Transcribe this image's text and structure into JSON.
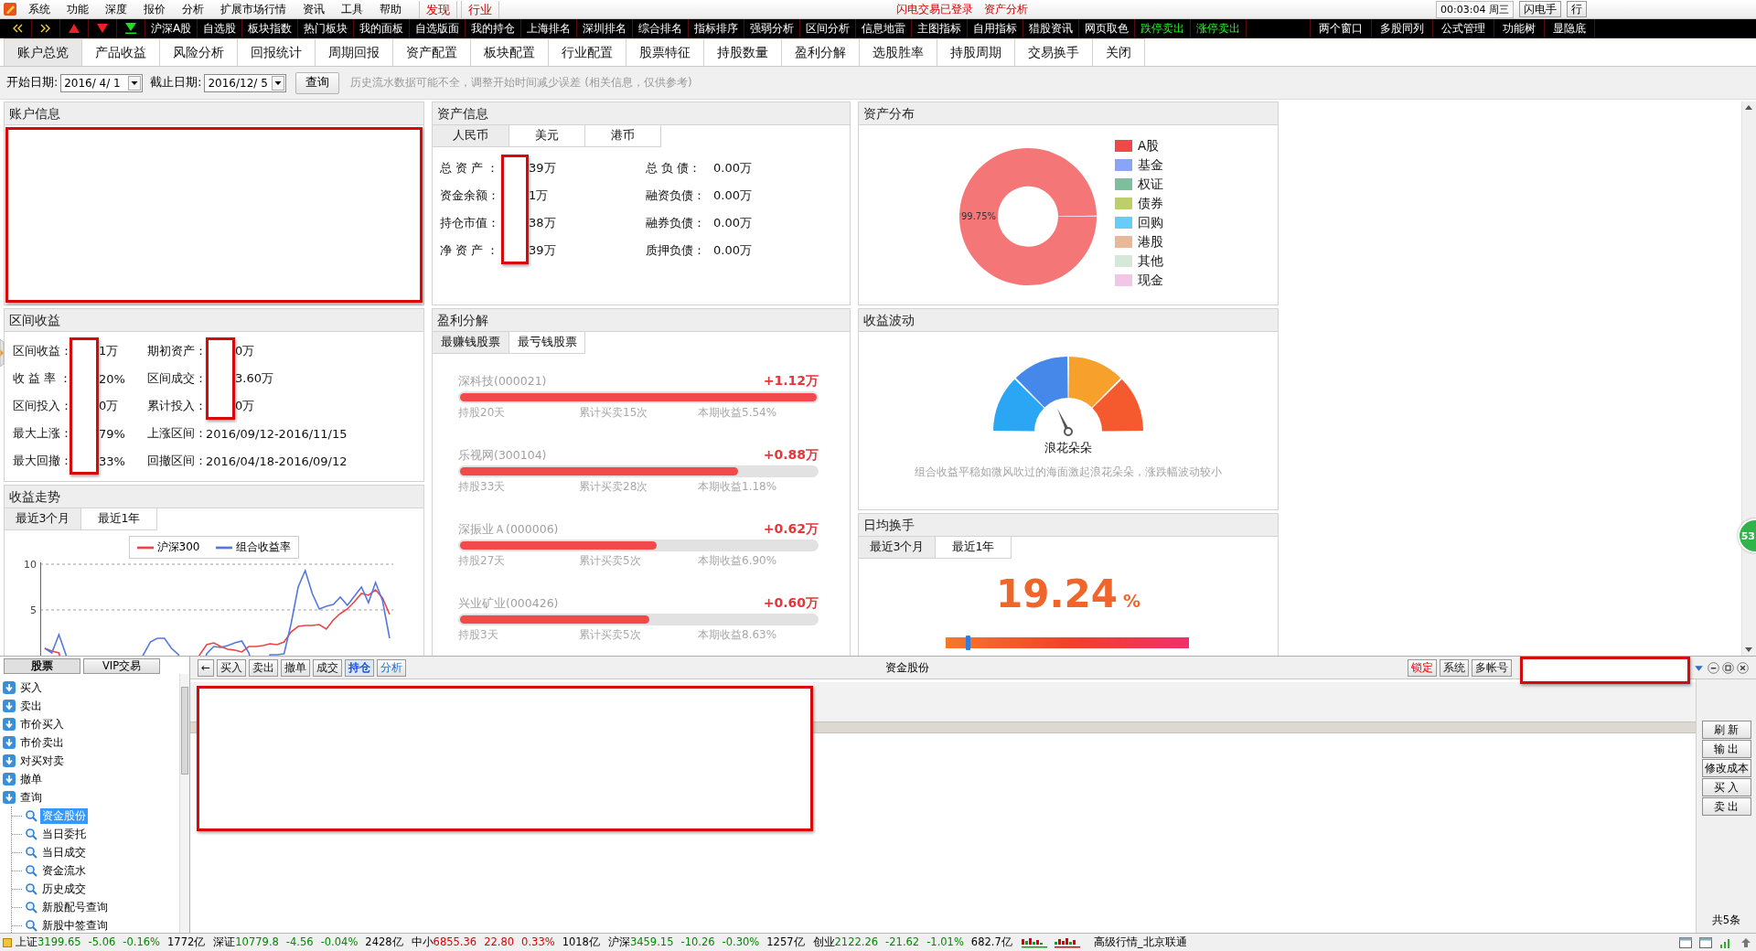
{
  "menu_bar": {
    "items": [
      "系统",
      "功能",
      "深度",
      "报价",
      "分析",
      "扩展市场行情",
      "资讯",
      "工具",
      "帮助"
    ],
    "tabs": [
      "发现",
      "行业"
    ],
    "links": [
      "闪电交易已登录",
      "资产分析"
    ],
    "clock": "00:03:04 周三",
    "buttons": [
      "闪电手",
      "行"
    ]
  },
  "quick_bar": {
    "items": [
      {
        "label": "沪深A股",
        "kind": "plain"
      },
      {
        "label": "自选股",
        "kind": "plain"
      },
      {
        "label": "板块指数",
        "kind": "plain"
      },
      {
        "label": "热门板块",
        "kind": "plain"
      },
      {
        "label": "我的面板",
        "kind": "plain"
      },
      {
        "label": "自选版面",
        "kind": "plain"
      },
      {
        "label": "我的持仓",
        "kind": "plain"
      },
      {
        "label": "上海排名",
        "kind": "plain"
      },
      {
        "label": "深圳排名",
        "kind": "plain"
      },
      {
        "label": "综合排名",
        "kind": "plain"
      },
      {
        "label": "指标排序",
        "kind": "plain"
      },
      {
        "label": "强弱分析",
        "kind": "plain"
      },
      {
        "label": "区间分析",
        "kind": "plain"
      },
      {
        "label": "信息地雷",
        "kind": "plain"
      },
      {
        "label": "主图指标",
        "kind": "plain"
      },
      {
        "label": "自用指标",
        "kind": "plain"
      },
      {
        "label": "猎股资讯",
        "kind": "plain"
      },
      {
        "label": "网页取色",
        "kind": "plain"
      },
      {
        "label": "跌停卖出",
        "kind": "accent"
      },
      {
        "label": "涨停卖出",
        "kind": "accent"
      }
    ],
    "right_items": [
      "两个窗口",
      "多股同列",
      "公式管理",
      "功能树",
      "显隐底"
    ]
  },
  "tabs": [
    {
      "label": "账户总览",
      "selected": true
    },
    {
      "label": "产品收益",
      "selected": false
    },
    {
      "label": "风险分析",
      "selected": false
    },
    {
      "label": "回报统计",
      "selected": false
    },
    {
      "label": "周期回报",
      "selected": false
    },
    {
      "label": "资产配置",
      "selected": false
    },
    {
      "label": "板块配置",
      "selected": false
    },
    {
      "label": "行业配置",
      "selected": false
    },
    {
      "label": "股票特征",
      "selected": false
    },
    {
      "label": "持股数量",
      "selected": false
    },
    {
      "label": "盈利分解",
      "selected": false
    },
    {
      "label": "选股胜率",
      "selected": false
    },
    {
      "label": "持股周期",
      "selected": false
    },
    {
      "label": "交易换手",
      "selected": false
    },
    {
      "label": "关闭",
      "selected": false
    }
  ],
  "date_filter": {
    "start_label": "开始日期:",
    "start_value": "2016/ 4/ 1",
    "end_label": "截止日期:",
    "end_value": "2016/12/ 5",
    "query_button": "查询",
    "hint": "历史流水数据可能不全，调整开始时间减少误差 (相关信息，仅供参考)"
  },
  "account_info": {
    "title": "账户信息"
  },
  "interval_returns": {
    "title": "区间收益",
    "left_rows": [
      {
        "label": "区间收益：",
        "value": "1万",
        "masked": true
      },
      {
        "label": "收 益 率 ：",
        "value": "20%",
        "masked": true
      },
      {
        "label": "区间投入：",
        "value": "0万",
        "masked": true
      },
      {
        "label": "最大上涨：",
        "value": "79%",
        "masked": true
      },
      {
        "label": "最大回撤：",
        "value": "33%",
        "masked": true
      }
    ],
    "right_rows": [
      {
        "label": "期初资产：",
        "value": "0万",
        "masked": true
      },
      {
        "label": "区间成交：",
        "value": "3.60万",
        "masked": true
      },
      {
        "label": "累计投入：",
        "value": "0万",
        "masked": true
      },
      {
        "label": "上涨区间：",
        "value": "2016/09/12-2016/11/15",
        "masked": false
      },
      {
        "label": "回撤区间：",
        "value": "2016/04/18-2016/09/12",
        "masked": false
      }
    ]
  },
  "returns_trend": {
    "title": "收益走势",
    "tabs": [
      {
        "label": "最近3个月",
        "selected": true
      },
      {
        "label": "最近1年",
        "selected": false
      }
    ],
    "chart_data": {
      "type": "line",
      "legend": "top",
      "ylim": [
        0,
        10
      ],
      "yticks": [
        5,
        10
      ],
      "series": [
        {
          "name": "沪深300",
          "color": "#e8474a",
          "values": [
            0.8,
            0.5,
            0.3,
            null,
            null,
            null,
            null,
            null,
            null,
            null,
            null,
            null,
            null,
            null,
            null,
            null,
            null,
            null,
            null,
            null,
            null,
            null,
            0.1,
            1.2,
            1.4,
            1.0,
            0.7,
            0.6,
            0.4,
            1.0,
            1.0,
            1.1,
            1.3,
            1.2,
            1.5,
            2.6,
            3.2,
            3.3,
            3.3,
            3.4,
            2.9,
            3.9,
            4.6,
            5.1,
            5.9,
            6.8,
            6.6,
            7.2,
            6.3,
            4.5
          ]
        },
        {
          "name": "组合收益率",
          "color": "#5578e0",
          "values": [
            0.8,
            0.3,
            2.3,
            0.1,
            null,
            null,
            null,
            null,
            null,
            null,
            null,
            null,
            null,
            null,
            0.1,
            1.5,
            1.9,
            1.9,
            0.8,
            0.1,
            null,
            null,
            null,
            0.2,
            1.0,
            0.9,
            1.1,
            1.4,
            1.6,
            0.3,
            null,
            null,
            0.1,
            0.1,
            0.2,
            3.5,
            7.5,
            9.3,
            6.8,
            5.1,
            5.4,
            5.6,
            6.4,
            5.5,
            6.5,
            7.5,
            5.8,
            8.0,
            6.0,
            1.9
          ]
        }
      ]
    }
  },
  "asset_info": {
    "title": "资产信息",
    "tabs": [
      {
        "label": "人民币",
        "selected": true
      },
      {
        "label": "美元",
        "selected": false
      },
      {
        "label": "港币",
        "selected": false
      }
    ],
    "left_rows": [
      {
        "label": "总 资 产 ：",
        "value": "39万",
        "masked": true
      },
      {
        "label": "资金余额：",
        "value": "1万",
        "masked": true
      },
      {
        "label": "持仓市值：",
        "value": "38万",
        "masked": true
      },
      {
        "label": "净 资 产 ：",
        "value": "39万",
        "masked": true
      }
    ],
    "right_rows": [
      {
        "label": "总 负 债：",
        "value": "0.00万"
      },
      {
        "label": "融资负债：",
        "value": "0.00万"
      },
      {
        "label": "融券负债：",
        "value": "0.00万"
      },
      {
        "label": "质押负债：",
        "value": "0.00万"
      }
    ]
  },
  "profit_breakdown": {
    "title": "盈利分解",
    "tabs": [
      {
        "label": "最赚钱股票",
        "selected": true
      },
      {
        "label": "最亏钱股票",
        "selected": false
      }
    ],
    "stocks": [
      {
        "name": "深科技(000021)",
        "profit": "+1.12万",
        "level": 1,
        "hold": "持股20天",
        "trades": "累计买卖15次",
        "return": "本期收益5.54%"
      },
      {
        "name": "乐视网(300104)",
        "profit": "+0.88万",
        "level": 0.78,
        "hold": "持股33天",
        "trades": "累计买卖28次",
        "return": "本期收益1.18%"
      },
      {
        "name": "深振业Ａ(000006)",
        "profit": "+0.62万",
        "level": 0.55,
        "hold": "持股27天",
        "trades": "累计买卖5次",
        "return": "本期收益6.90%"
      },
      {
        "name": "兴业矿业(000426)",
        "profit": "+0.60万",
        "level": 0.53,
        "hold": "持股3天",
        "trades": "累计买卖5次",
        "return": "本期收益8.63%"
      }
    ]
  },
  "asset_distribution": {
    "title": "资产分布",
    "chart_data": {
      "type": "donut",
      "legend": "right",
      "categories": [
        "A股",
        "基金",
        "权证",
        "债券",
        "回购",
        "港股",
        "其他",
        "现金"
      ],
      "values": [
        99.75,
        0,
        0,
        0,
        0,
        0,
        0,
        0.25
      ],
      "value_labels": [
        "99.75%",
        null,
        null,
        null,
        null,
        null,
        null,
        null
      ],
      "colors": [
        "#f04848",
        "#8aa4f8",
        "#7dbf9c",
        "#bccf6a",
        "#66ccf8",
        "#e8b898",
        "#d6e8d8",
        "#f0c8e6"
      ]
    }
  },
  "volatility": {
    "title": "收益波动",
    "level": 0.36,
    "label": "浪花朵朵",
    "description": "组合收益平稳如微风吹过的海面激起浪花朵朵，涨跌幅波动较小"
  },
  "turnover": {
    "title": "日均换手",
    "tabs": [
      {
        "label": "最近3个月",
        "selected": true
      },
      {
        "label": "最近1年",
        "selected": false
      }
    ],
    "value": "19.24",
    "unit": "%",
    "level": 0.09
  },
  "trade": {
    "side_tabs": [
      {
        "label": "股票",
        "selected": true
      },
      {
        "label": "VIP交易",
        "selected": false
      }
    ],
    "tree": [
      {
        "label": "买入",
        "selected": false
      },
      {
        "label": "卖出",
        "selected": false
      },
      {
        "label": "市价买入",
        "selected": false
      },
      {
        "label": "市价卖出",
        "selected": false
      },
      {
        "label": "对买对卖",
        "selected": false
      },
      {
        "label": "撤单",
        "selected": false
      },
      {
        "label": "查询",
        "selected": false,
        "children": [
          {
            "label": "资金股份",
            "selected": true
          },
          {
            "label": "当日委托",
            "selected": false
          },
          {
            "label": "当日成交",
            "selected": false
          },
          {
            "label": "资金流水",
            "selected": false
          },
          {
            "label": "历史成交",
            "selected": false
          },
          {
            "label": "新股配号查询",
            "selected": false
          },
          {
            "label": "新股中签查询",
            "selected": false
          }
        ]
      }
    ],
    "toolbar": {
      "back": "←",
      "buttons": [
        {
          "label": "买入",
          "kind": "command",
          "selected": false
        },
        {
          "label": "卖出",
          "kind": "command",
          "selected": false
        },
        {
          "label": "撤单",
          "kind": "command",
          "selected": false
        },
        {
          "label": "成交",
          "kind": "command",
          "selected": false
        },
        {
          "label": "持仓",
          "kind": "view",
          "selected": true
        },
        {
          "label": "分析",
          "kind": "view",
          "selected": false
        }
      ],
      "title": "资金股份",
      "right_buttons": [
        {
          "label": "锁定",
          "kind": "alert"
        },
        {
          "label": "系统",
          "kind": "normal"
        },
        {
          "label": "多帐号",
          "kind": "normal"
        }
      ]
    },
    "side_buttons": [
      "刷 新",
      "输 出",
      "修改成本",
      "买 入",
      "卖 出"
    ],
    "count": "共5条"
  },
  "status_bar": {
    "indices": [
      {
        "name": "上证",
        "value": "3199.65",
        "change": "-5.06",
        "percent": "-0.16%",
        "amount": "1772亿",
        "rising": false
      },
      {
        "name": "深证",
        "value": "10779.8",
        "change": "-4.56",
        "percent": "-0.04%",
        "amount": "2428亿",
        "rising": false
      },
      {
        "name": "中小",
        "value": "6855.36",
        "change": "22.80",
        "percent": "0.33%",
        "amount": "1018亿",
        "rising": true
      },
      {
        "name": "沪深",
        "value": "3459.15",
        "change": "-10.26",
        "percent": "-0.30%",
        "amount": "1257亿",
        "rising": false
      },
      {
        "name": "创业",
        "value": "2122.26",
        "change": "-21.62",
        "percent": "-1.01%",
        "amount": "682.7亿",
        "rising": false
      }
    ],
    "network": "高级行情_北京联通"
  },
  "badge": "53"
}
